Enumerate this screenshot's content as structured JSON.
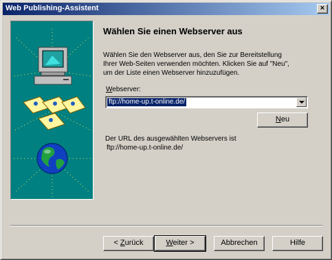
{
  "window": {
    "title": "Web Publishing-Assistent",
    "close_glyph": "×"
  },
  "main": {
    "heading": "Wählen Sie einen Webserver aus",
    "intro_lines": [
      "Wählen Sie den Webserver aus, den Sie zur Bereitstellung",
      "Ihrer Web-Seiten verwenden möchten. Klicken Sie auf \"Neu\",",
      "um der Liste einen Webserver hinzuzufügen."
    ],
    "webserver_label_mn": "W",
    "webserver_label_rest": "ebserver:",
    "webserver_value": "ftp://home-up.t-online.de/",
    "new_button_mn": "N",
    "new_button_rest": "eu",
    "url_label": "Der URL des ausgewählten Webservers ist",
    "url_value": "ftp://home-up.t-online.de/"
  },
  "buttons": {
    "back_prefix": "< ",
    "back_mn": "Z",
    "back_rest": "urück",
    "next_mn": "W",
    "next_rest": "eiter >",
    "cancel": "Abbrechen",
    "help": "Hilfe"
  },
  "illustration": {
    "icons": [
      "computer-icon",
      "web-pages-icon",
      "globe-icon"
    ],
    "background_color": "#008080"
  },
  "colors": {
    "title_bar_start": "#0a246a",
    "title_bar_end": "#a6caf0",
    "selection": "#0a246a",
    "face": "#d4d0c8"
  }
}
